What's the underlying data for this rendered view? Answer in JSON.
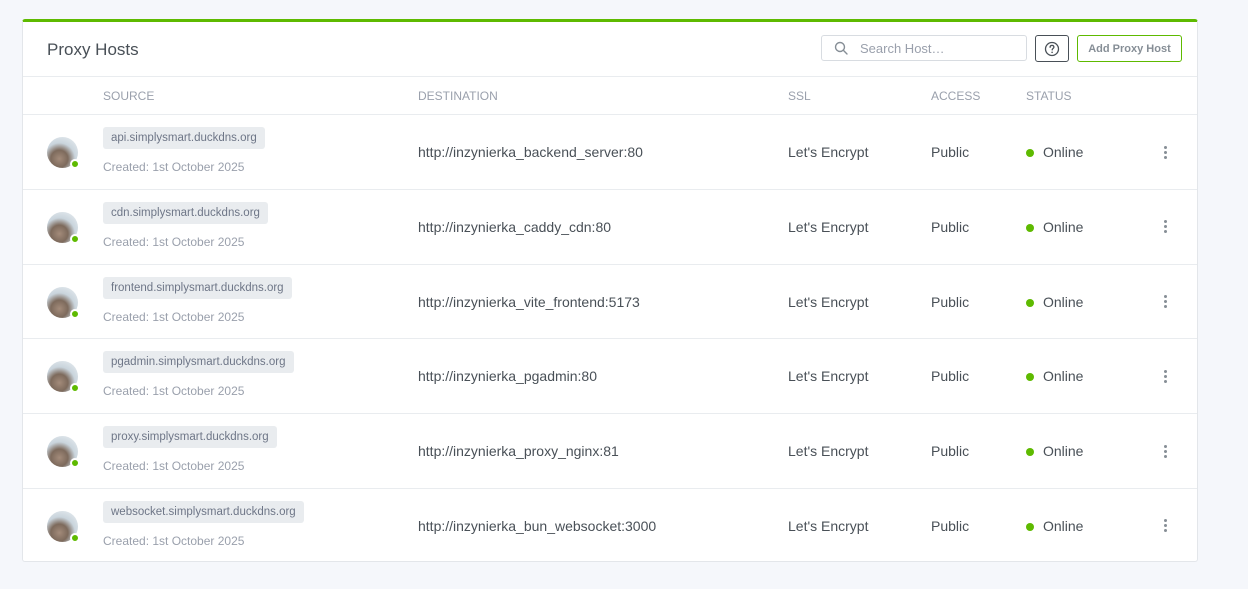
{
  "header": {
    "title": "Proxy Hosts",
    "search_placeholder": "Search Host…",
    "help_icon": "question-circle-icon",
    "add_label": "Add Proxy Host"
  },
  "columns": {
    "source": "SOURCE",
    "destination": "DESTINATION",
    "ssl": "SSL",
    "access": "ACCESS",
    "status": "STATUS"
  },
  "colors": {
    "accent": "#5eba00",
    "tag_bg": "#e9ecef"
  },
  "rows": [
    {
      "source": "api.simplysmart.duckdns.org",
      "created": "Created: 1st October 2025",
      "destination": "http://inzynierka_backend_server:80",
      "ssl": "Let's Encrypt",
      "access": "Public",
      "status": "Online"
    },
    {
      "source": "cdn.simplysmart.duckdns.org",
      "created": "Created: 1st October 2025",
      "destination": "http://inzynierka_caddy_cdn:80",
      "ssl": "Let's Encrypt",
      "access": "Public",
      "status": "Online"
    },
    {
      "source": "frontend.simplysmart.duckdns.org",
      "created": "Created: 1st October 2025",
      "destination": "http://inzynierka_vite_frontend:5173",
      "ssl": "Let's Encrypt",
      "access": "Public",
      "status": "Online"
    },
    {
      "source": "pgadmin.simplysmart.duckdns.org",
      "created": "Created: 1st October 2025",
      "destination": "http://inzynierka_pgadmin:80",
      "ssl": "Let's Encrypt",
      "access": "Public",
      "status": "Online"
    },
    {
      "source": "proxy.simplysmart.duckdns.org",
      "created": "Created: 1st October 2025",
      "destination": "http://inzynierka_proxy_nginx:81",
      "ssl": "Let's Encrypt",
      "access": "Public",
      "status": "Online"
    },
    {
      "source": "websocket.simplysmart.duckdns.org",
      "created": "Created: 1st October 2025",
      "destination": "http://inzynierka_bun_websocket:3000",
      "ssl": "Let's Encrypt",
      "access": "Public",
      "status": "Online"
    }
  ]
}
